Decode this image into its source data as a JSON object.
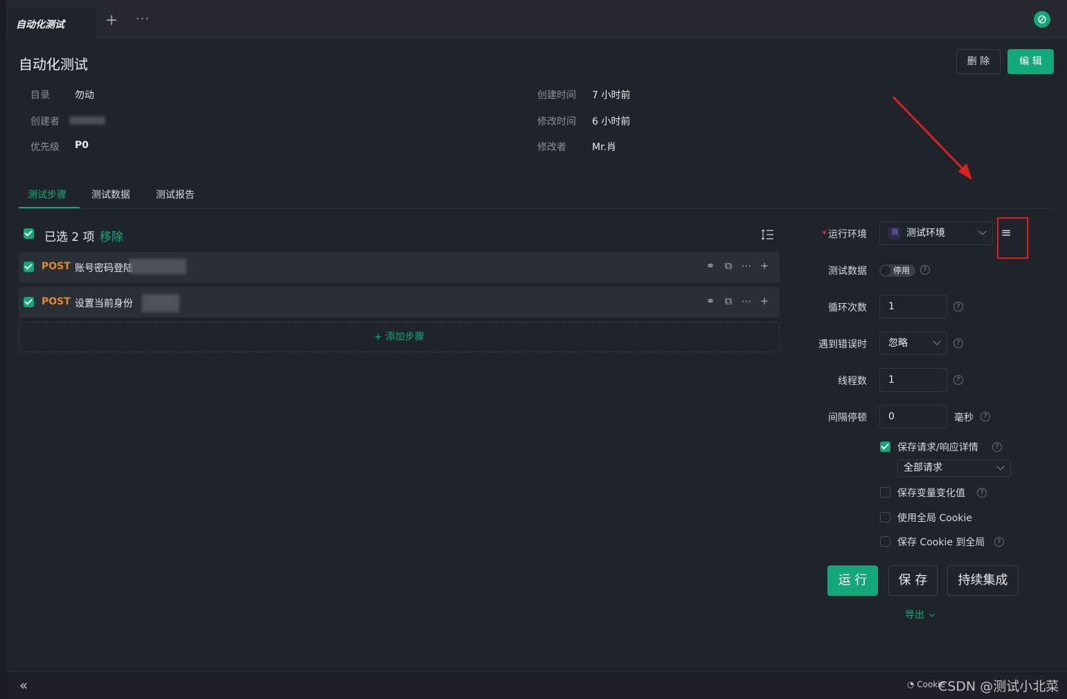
{
  "tabbar": {
    "active_tab": "自动化测试",
    "plus": "+",
    "more": "···",
    "sync_icon": "sync-icon"
  },
  "header": {
    "title": "自动化测试",
    "delete_label": "删 除",
    "edit_label": "编 辑"
  },
  "meta": {
    "folder_label": "目录",
    "folder_value": "勿动",
    "creator_label": "创建者",
    "priority_label": "优先级",
    "priority_value": "P0",
    "created_label": "创建时间",
    "created_value": "7 小时前",
    "modified_label": "修改时间",
    "modified_value": "6 小时前",
    "modifier_label": "修改者",
    "modifier_value": "Mr.肖"
  },
  "tabs": [
    {
      "label": "测试步骤",
      "active": true
    },
    {
      "label": "测试数据",
      "active": false
    },
    {
      "label": "测试报告",
      "active": false
    }
  ],
  "selection": {
    "count_text": "已选 2 项",
    "remove_label": "移除"
  },
  "steps": [
    {
      "method": "POST",
      "name": "账号密码登陆"
    },
    {
      "method": "POST",
      "name": "设置当前身份"
    }
  ],
  "add_step_label": "+ 添加步骤",
  "settings": {
    "env_label": "运行环境",
    "env_badge": "测",
    "env_value": "测试环境",
    "test_data_label": "测试数据",
    "test_data_toggle": "停用",
    "loop_label": "循环次数",
    "loop_value": "1",
    "on_error_label": "遇到错误时",
    "on_error_value": "忽略",
    "threads_label": "线程数",
    "threads_value": "1",
    "interval_label": "间隔停顿",
    "interval_value": "0",
    "interval_unit": "毫秒",
    "save_detail_label": "保存请求/响应详情",
    "save_detail_checked": true,
    "save_detail_scope": "全部请求",
    "save_var_label": "保存变量变化值",
    "save_var_checked": false,
    "global_cookie_label": "使用全局 Cookie",
    "global_cookie_checked": false,
    "save_cookie_label": "保存 Cookie 到全局",
    "save_cookie_checked": false
  },
  "actions": {
    "run": "运 行",
    "save": "保 存",
    "ci": "持续集成",
    "export": "导出"
  },
  "footer": {
    "cookie_label": "Cookie",
    "watermark": "CSDN @测试小北菜"
  },
  "colors": {
    "accent": "#13a87a",
    "post": "#e08a2c",
    "annotation": "#e02020",
    "background": "#1f232a"
  }
}
